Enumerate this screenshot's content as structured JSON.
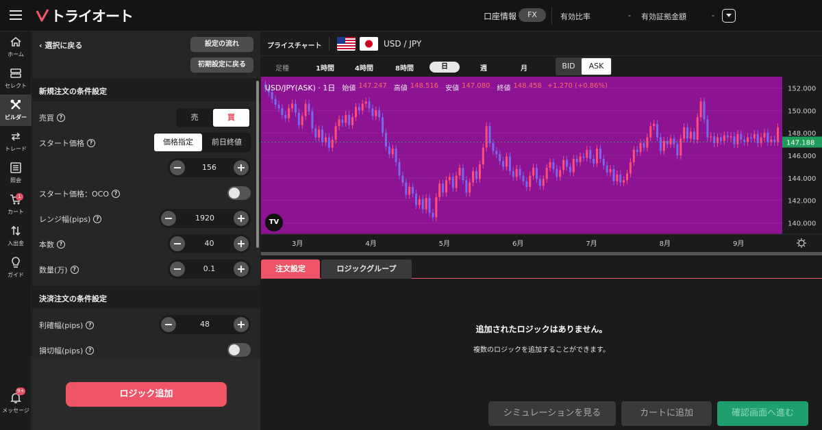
{
  "topbar": {
    "brand": "トライオート",
    "account_info": "口座情報",
    "account_type": "FX",
    "ratio_label": "有効比率",
    "ratio_value": "-",
    "margin_label": "有効証拠金額",
    "margin_value": "-"
  },
  "nav": [
    {
      "label": "ホーム",
      "icon": "home-icon"
    },
    {
      "label": "セレクト",
      "icon": "select-icon"
    },
    {
      "label": "ビルダー",
      "icon": "builder-tools-icon",
      "active": true
    },
    {
      "label": "トレード",
      "icon": "trade-arrows-icon"
    },
    {
      "label": "照会",
      "icon": "list-icon"
    },
    {
      "label": "カート",
      "icon": "cart-icon",
      "badge": "1"
    },
    {
      "label": "入出金",
      "icon": "transfer-icon"
    },
    {
      "label": "ガイド",
      "icon": "lightbulb-icon"
    },
    {
      "label": "メッセージ",
      "icon": "bell-icon",
      "badge": "9+"
    }
  ],
  "panel": {
    "back": "選択に戻る",
    "settings_flow": "設定の流れ",
    "reset_initial": "初期設定に戻る",
    "new_order_title": "新規注文の条件設定",
    "side_label": "売買",
    "side_options": [
      "売",
      "買"
    ],
    "side_selected": "買",
    "start_price_label": "スタート価格",
    "start_price_options": [
      "価格指定",
      "前日終値"
    ],
    "start_price_value": "156",
    "oco_label": "スタート価格：OCO",
    "range_label": "レンジ幅(pips)",
    "range_value": "1920",
    "count_label": "本数",
    "count_value": "40",
    "qty_label": "数量(万)",
    "qty_value": "0.1",
    "close_order_title": "決済注文の条件設定",
    "tp_label": "利確幅(pips)",
    "tp_value": "48",
    "sl_label": "損切幅(pips)",
    "add_logic": "ロジック追加"
  },
  "chart_header": {
    "title": "プライスチャート",
    "pair_base": "USD",
    "pair_sep": "/",
    "pair_quote": "JPY"
  },
  "timeframes": [
    "足種",
    "1時間",
    "4時間",
    "8時間",
    "日",
    "週",
    "月"
  ],
  "timeframe_selected": "日",
  "price_side": {
    "bid": "BID",
    "ask": "ASK",
    "selected": "ASK"
  },
  "chart_info": {
    "symbol": "USD/JPY(ASK) · 1日",
    "open_label": "始値",
    "open": "147.247",
    "high_label": "高値",
    "high": "148.516",
    "low_label": "安値",
    "low": "147.080",
    "close_label": "終値",
    "close": "148.458",
    "change": "+1.270 (+0.86%)"
  },
  "chart_data": {
    "type": "candlestick",
    "x_ticks": [
      "3月",
      "4月",
      "5月",
      "6月",
      "7月",
      "8月",
      "9月"
    ],
    "y_ticks": [
      "152.000",
      "150.000",
      "148.000",
      "146.000",
      "144.000",
      "142.000",
      "140.000"
    ],
    "ylim": [
      139.0,
      153.0
    ],
    "last_price": "147.188",
    "background": "#8c1391",
    "up_color": "#ff4f7a",
    "down_color": "#7b68ee",
    "closes": [
      152.0,
      151.6,
      151.0,
      150.5,
      150.2,
      149.6,
      149.3,
      150.2,
      150.6,
      149.8,
      148.7,
      149.5,
      150.6,
      149.9,
      148.4,
      147.6,
      148.3,
      147.2,
      147.6,
      146.7,
      147.4,
      148.6,
      149.2,
      148.9,
      149.6,
      148.7,
      149.4,
      150.3,
      150.0,
      150.6,
      150.8,
      150.2,
      149.5,
      150.0,
      149.4,
      148.0,
      146.8,
      146.1,
      146.6,
      145.4,
      144.2,
      143.6,
      142.5,
      143.2,
      142.6,
      141.6,
      142.1,
      141.2,
      142.2,
      140.9,
      140.5,
      142.3,
      143.5,
      142.7,
      143.8,
      144.1,
      143.1,
      144.2,
      144.9,
      143.8,
      142.7,
      143.6,
      144.6,
      143.9,
      145.2,
      146.7,
      148.6,
      147.1,
      146.4,
      146.1,
      145.5,
      145.0,
      145.9,
      144.6,
      144.1,
      144.8,
      144.2,
      143.7,
      143.2,
      144.2,
      144.9,
      143.9,
      143.3,
      143.9,
      144.9,
      145.4,
      144.8,
      144.1,
      144.7,
      145.6,
      145.0,
      144.5,
      145.7,
      145.4,
      145.9,
      145.8,
      146.5,
      145.7,
      145.3,
      146.6,
      145.7,
      145.1,
      144.5,
      144.8,
      143.7,
      144.3,
      143.6,
      143.8,
      144.4,
      145.4,
      146.5,
      146.3,
      147.1,
      146.7,
      147.6,
      148.6,
      148.8,
      147.6,
      146.4,
      147.3,
      147.0,
      147.5,
      147.0,
      146.0,
      147.5,
      148.5,
      147.5,
      148.1,
      147.4,
      149.4,
      150.8,
      149.2,
      147.6,
      147.7,
      147.1,
      147.6,
      147.3,
      147.8,
      147.6,
      147.7,
      147.0,
      147.9,
      147.4,
      147.2,
      147.6,
      147.5,
      147.9,
      147.1,
      147.6,
      148.0,
      147.2,
      147.4,
      147.2,
      148.5
    ]
  },
  "tabs": [
    "注文設定",
    "ロジックグループ"
  ],
  "empty": {
    "title": "追加されたロジックはありません。",
    "sub": "複数のロジックを追加することができます。"
  },
  "actions": {
    "simulate": "シミュレーションを見る",
    "add_cart": "カートに追加",
    "confirm": "確認画面へ進む"
  }
}
